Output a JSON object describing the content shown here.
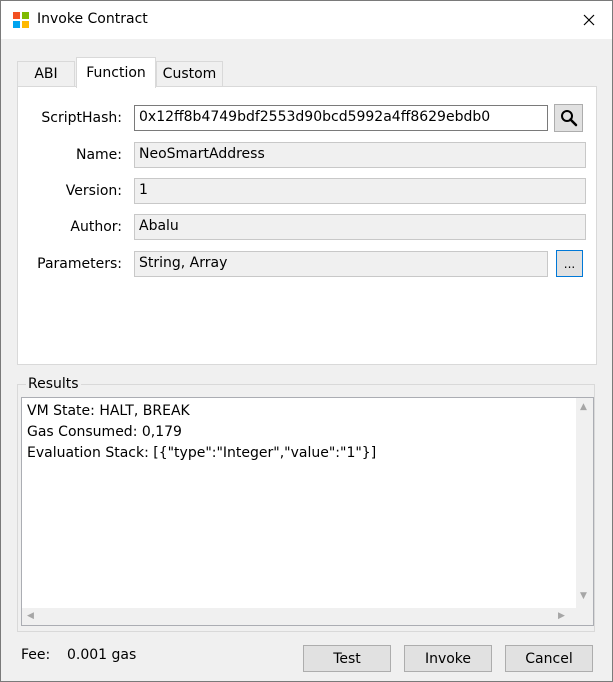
{
  "window": {
    "title": "Invoke Contract"
  },
  "tabs": [
    {
      "label": "ABI",
      "active": false
    },
    {
      "label": "Function",
      "active": true
    },
    {
      "label": "Custom",
      "active": false
    }
  ],
  "form": {
    "scripthash_label": "ScriptHash:",
    "scripthash_value": "0x12ff8b4749bdf2553d90bcd5992a4ff8629ebdb0",
    "name_label": "Name:",
    "name_value": "NeoSmartAddress",
    "version_label": "Version:",
    "version_value": "1",
    "author_label": "Author:",
    "author_value": "Abalu",
    "parameters_label": "Parameters:",
    "parameters_value": "String, Array",
    "parameters_button": "..."
  },
  "results": {
    "group_label": "Results",
    "lines": [
      "VM State: HALT, BREAK",
      "Gas Consumed: 0,179",
      "Evaluation Stack: [{\"type\":\"Integer\",\"value\":\"1\"}]"
    ]
  },
  "footer": {
    "fee_label": "Fee:",
    "fee_value": "0.001 gas",
    "test_label": "Test",
    "invoke_label": "Invoke",
    "cancel_label": "Cancel"
  },
  "icons": {
    "app": "app-window-icon",
    "close": "close-icon",
    "search": "search-icon"
  },
  "colors": {
    "focus_border": "#0078d7",
    "window_bg": "#f0f0f0"
  }
}
